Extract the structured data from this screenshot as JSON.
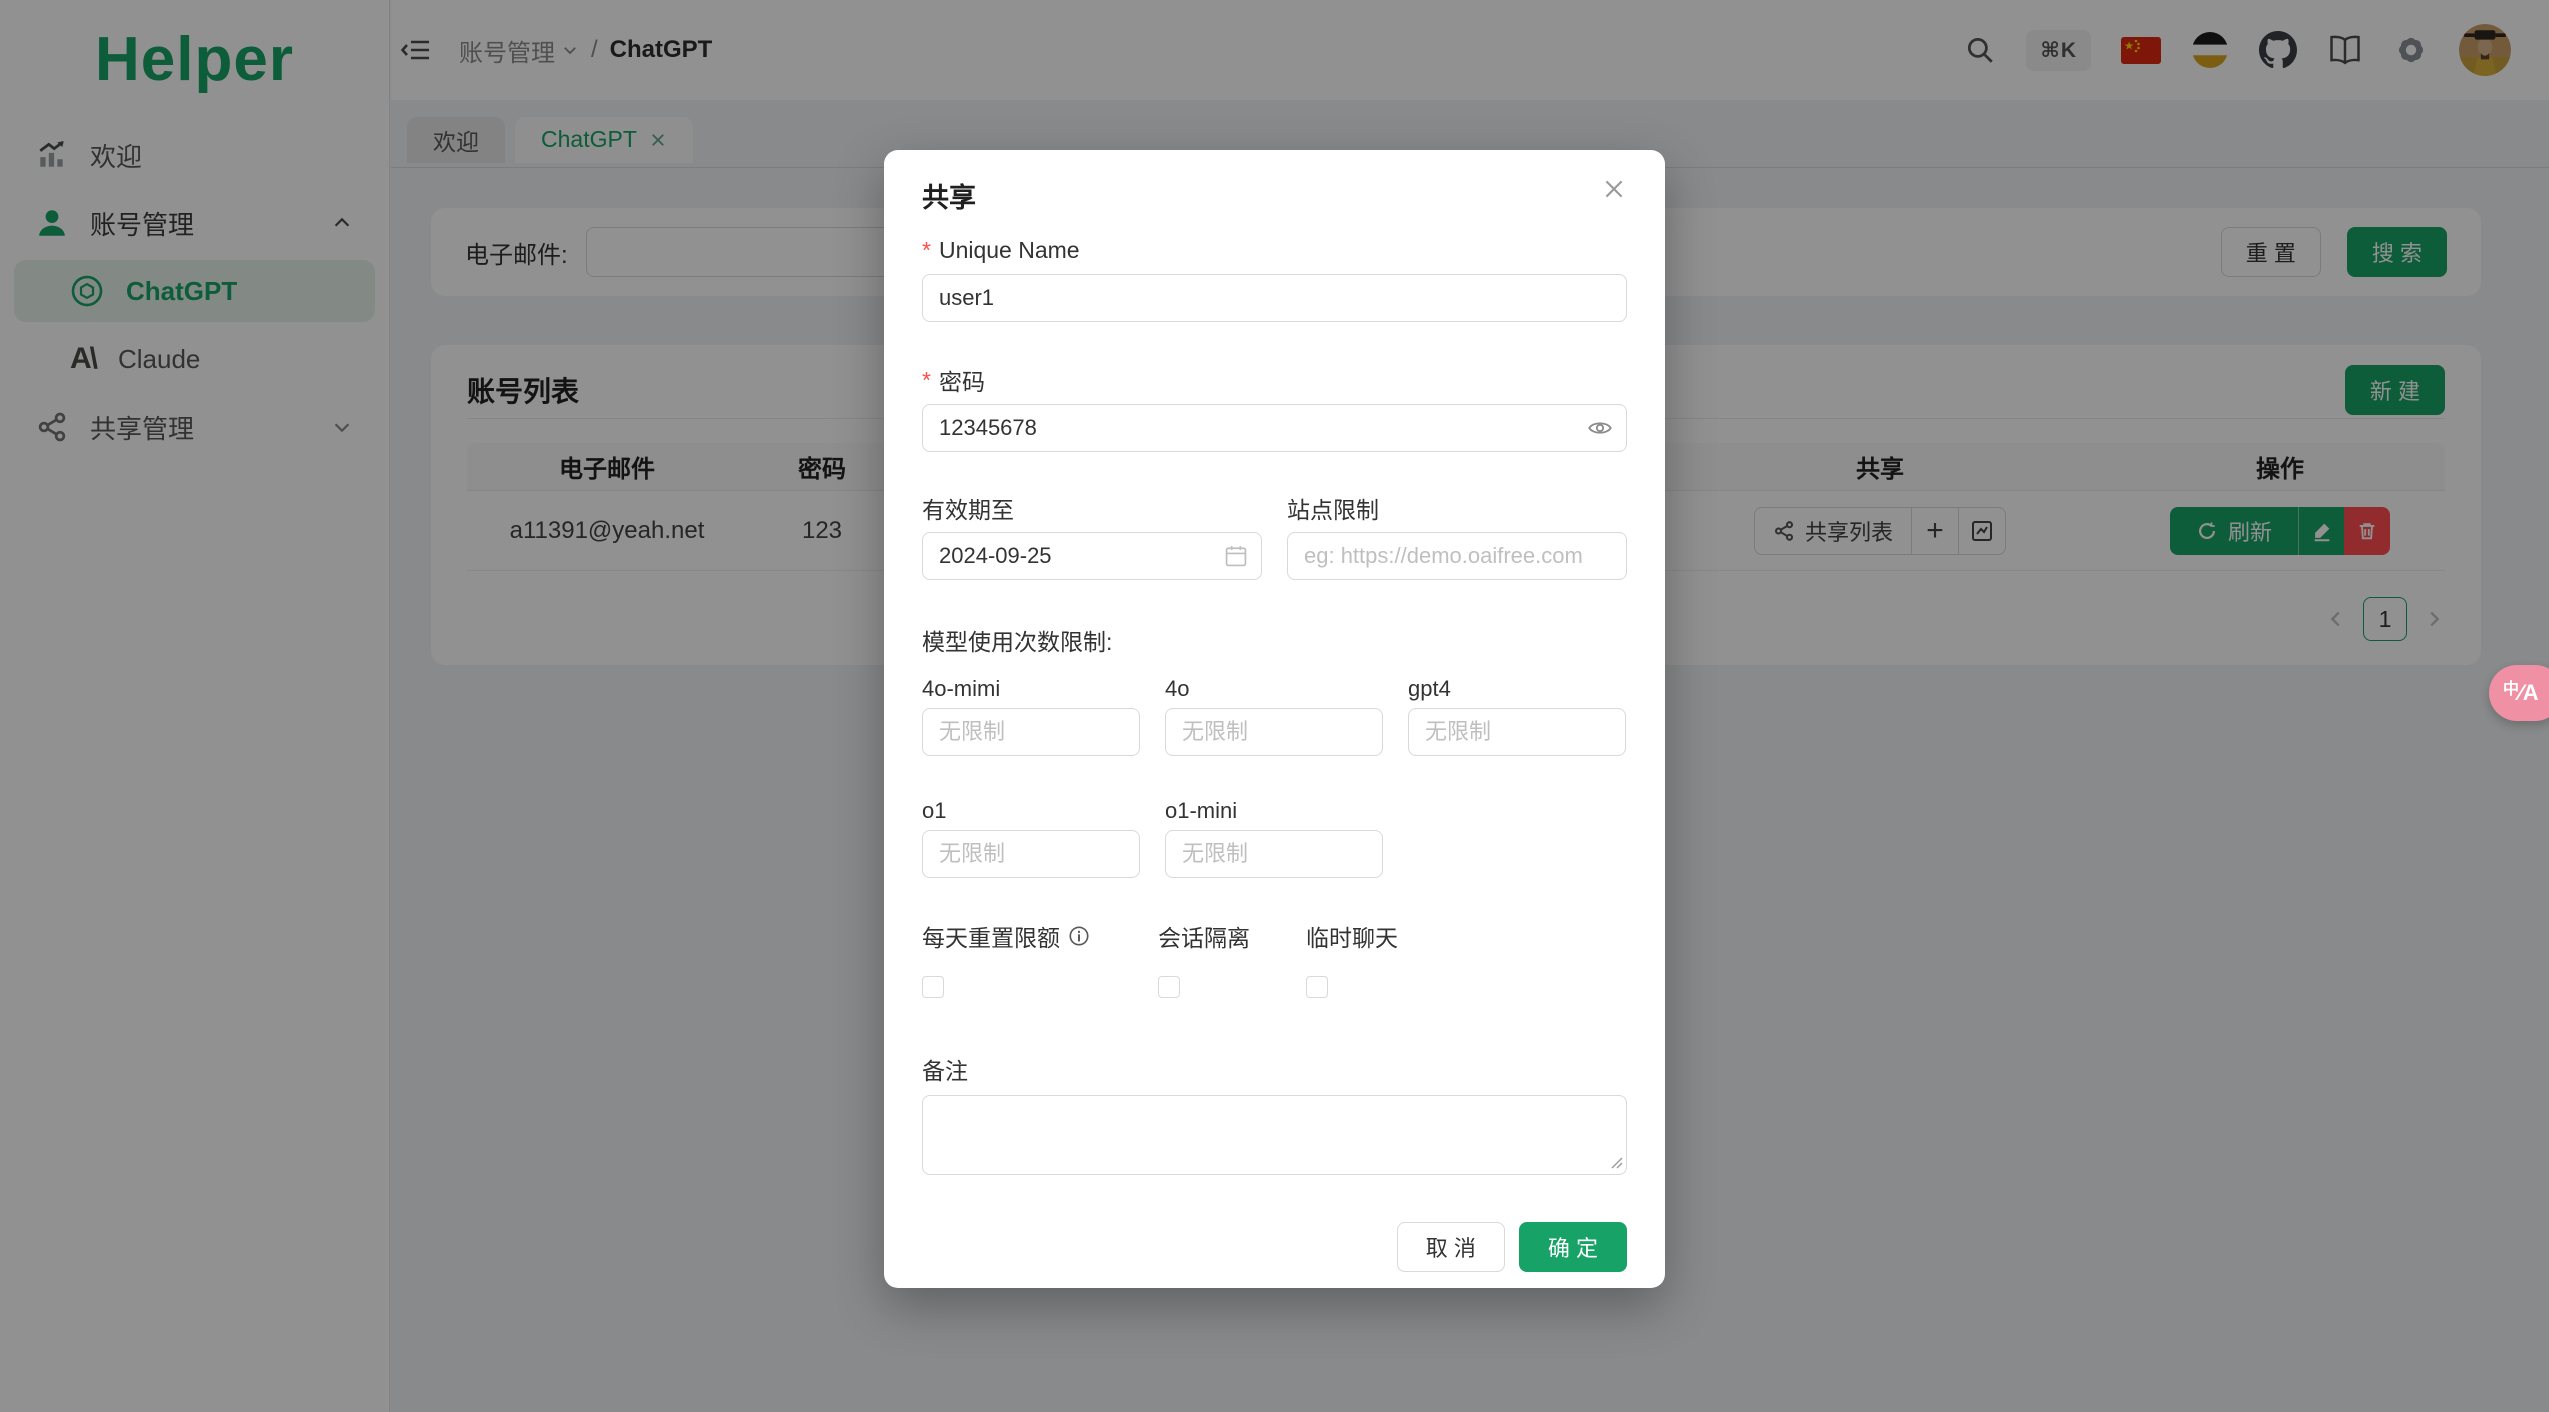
{
  "theme": {
    "primary": "#17a267",
    "danger": "#ff4d4f",
    "pink": "#ef90a5"
  },
  "sidebar": {
    "logo": "Helper",
    "welcome": "欢迎",
    "account_mgmt": "账号管理",
    "chatgpt": "ChatGPT",
    "claude": "Claude",
    "claude_mark": "A\\",
    "share_mgmt": "共享管理"
  },
  "topbar": {
    "breadcrumb_parent": "账号管理",
    "breadcrumb_sep": "/",
    "breadcrumb_current": "ChatGPT",
    "shortcut": "⌘K"
  },
  "tabs": {
    "welcome": "欢迎",
    "chatgpt": "ChatGPT"
  },
  "filter": {
    "email_label": "电子邮件:",
    "reset": "重 置",
    "search": "搜 索"
  },
  "list": {
    "title": "账号列表",
    "new_button": "新 建",
    "col_email": "电子邮件",
    "col_password": "密码",
    "col_share": "共享",
    "col_actions": "操作",
    "row": {
      "email": "a11391@yeah.net",
      "password": "123",
      "share_list": "共享列表",
      "plus": "+",
      "refresh": "刷新"
    },
    "page": "1"
  },
  "modal": {
    "title": "共享",
    "unique_name_label": "Unique Name",
    "unique_name_value": "user1",
    "password_label": "密码",
    "password_value": "12345678",
    "expiry_label": "有效期至",
    "expiry_value": "2024-09-25",
    "site_label": "站点限制",
    "site_placeholder": "eg: https://demo.oaifree.com",
    "models_title": "模型使用次数限制:",
    "m1": "4o-mimi",
    "m2": "4o",
    "m3": "gpt4",
    "m4": "o1",
    "m5": "o1-mini",
    "unlimited": "无限制",
    "cb1": "每天重置限额",
    "cb2": "会话隔离",
    "cb3": "临时聊天",
    "remark_label": "备注",
    "cancel": "取 消",
    "ok": "确 定"
  },
  "fab": {
    "zh": "中",
    "en": "A"
  }
}
